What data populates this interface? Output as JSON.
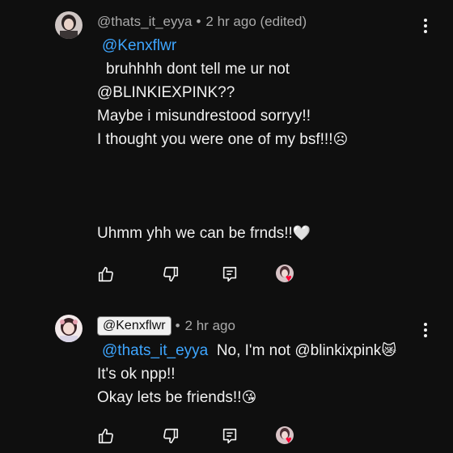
{
  "comments": [
    {
      "author": "@thats_it_eyya",
      "separator": "•",
      "time": "2 hr ago (edited)",
      "mention": "@Kenxflwr",
      "lines": [
        "bruhhhh dont tell me ur not",
        "@BLINKIEXPINK??",
        "Maybe i misundrestood sorryy!!",
        "I thought you were one of my bsf!!!",
        "",
        "",
        "",
        "Uhmm yhh we can be frnds!!"
      ],
      "emoji_line4": "☹",
      "emoji_line8": "🤍"
    },
    {
      "author": "@Kenxflwr",
      "separator": "•",
      "time": "2 hr ago",
      "mention": "@thats_it_eyya",
      "reply_text": "No, I'm not @blinkixpink",
      "emoji_reply": "😿",
      "lines": [
        "It's ok npp!!",
        "Okay lets be friends!!"
      ],
      "emoji_last": "😘"
    }
  ],
  "icons": {
    "like": "thumbs-up-icon",
    "dislike": "thumbs-down-icon",
    "reply": "reply-icon",
    "more": "more-vert-icon",
    "creator_heart": "creator-heart-icon"
  },
  "colors": {
    "background": "#0f0f0f",
    "text": "#f1f1f1",
    "meta": "#aaaaaa",
    "mention": "#3ea6ff",
    "heart": "#ff0033"
  }
}
